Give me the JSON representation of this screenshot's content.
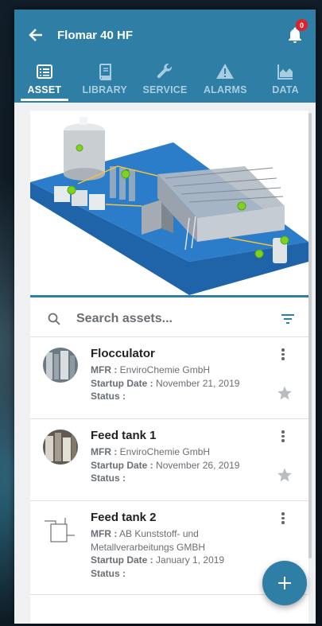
{
  "header": {
    "title": "Flomar 40 HF",
    "alarm_count": "0"
  },
  "tabs": [
    {
      "label": "ASSET",
      "icon": "list-icon",
      "active": true
    },
    {
      "label": "LIBRARY",
      "icon": "book-icon",
      "active": false
    },
    {
      "label": "SERVICE",
      "icon": "wrench-icon",
      "active": false
    },
    {
      "label": "ALARMS",
      "icon": "warning-icon",
      "active": false
    },
    {
      "label": "DATA",
      "icon": "area-chart-icon",
      "active": false
    }
  ],
  "search": {
    "placeholder": "Search assets..."
  },
  "assets": [
    {
      "name": "Flocculator",
      "mfr_label": "MFR :",
      "mfr": "EnviroChemie GmbH",
      "startup_label": "Startup Date :",
      "startup": "November 21, 2019",
      "status_label": "Status :",
      "status": ""
    },
    {
      "name": "Feed tank 1",
      "mfr_label": "MFR :",
      "mfr": "EnviroChemie GmbH",
      "startup_label": "Startup Date :",
      "startup": "November 26, 2019",
      "status_label": "Status :",
      "status": ""
    },
    {
      "name": "Feed tank 2",
      "mfr_label": "MFR :",
      "mfr": "AB Kunststoff- und Metallverarbeitungs GMBH",
      "startup_label": "Startup Date :",
      "startup": "January 1, 2019",
      "status_label": "Status :",
      "status": ""
    }
  ],
  "colors": {
    "primary": "#2f7ea6",
    "tab_inactive": "#a8cde0",
    "badge": "#e0202a",
    "status_dot": "#7ed321"
  }
}
